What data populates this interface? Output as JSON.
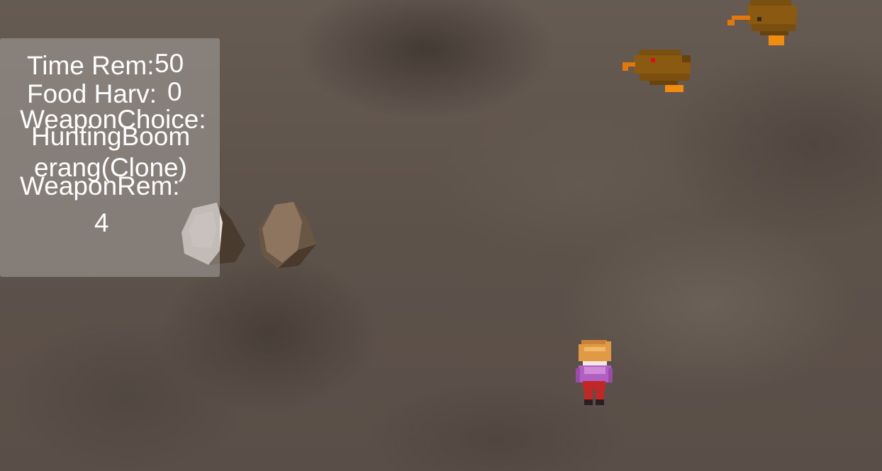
{
  "hud": {
    "time_label": "Time Rem:",
    "time_value": "50",
    "food_label": "Food Harv:",
    "food_value": "0",
    "weapon_choice_label": "WeaponChoice:",
    "weapon_choice_value_line1": "HuntingBoom",
    "weapon_choice_value_line2": "erang(Clone)",
    "weapon_rem_label": "WeaponRem:",
    "weapon_rem_value": "4"
  },
  "scene": {
    "objects": [
      {
        "type": "rock-light",
        "name": "rock"
      },
      {
        "type": "rock-dark",
        "name": "rock"
      },
      {
        "type": "kiwi-bird",
        "name": "kiwi-bird",
        "eye_color": "#e01010"
      },
      {
        "type": "kiwi-bird",
        "name": "kiwi-bird",
        "eye_color": "#3a2a10"
      },
      {
        "type": "player",
        "name": "player-character"
      }
    ],
    "colors": {
      "kiwi_body": "#8a5a12",
      "kiwi_feet": "#f08c10",
      "player_hair": "#e09a45",
      "player_shirt": "#b060c0",
      "player_pants": "#c02828"
    }
  }
}
